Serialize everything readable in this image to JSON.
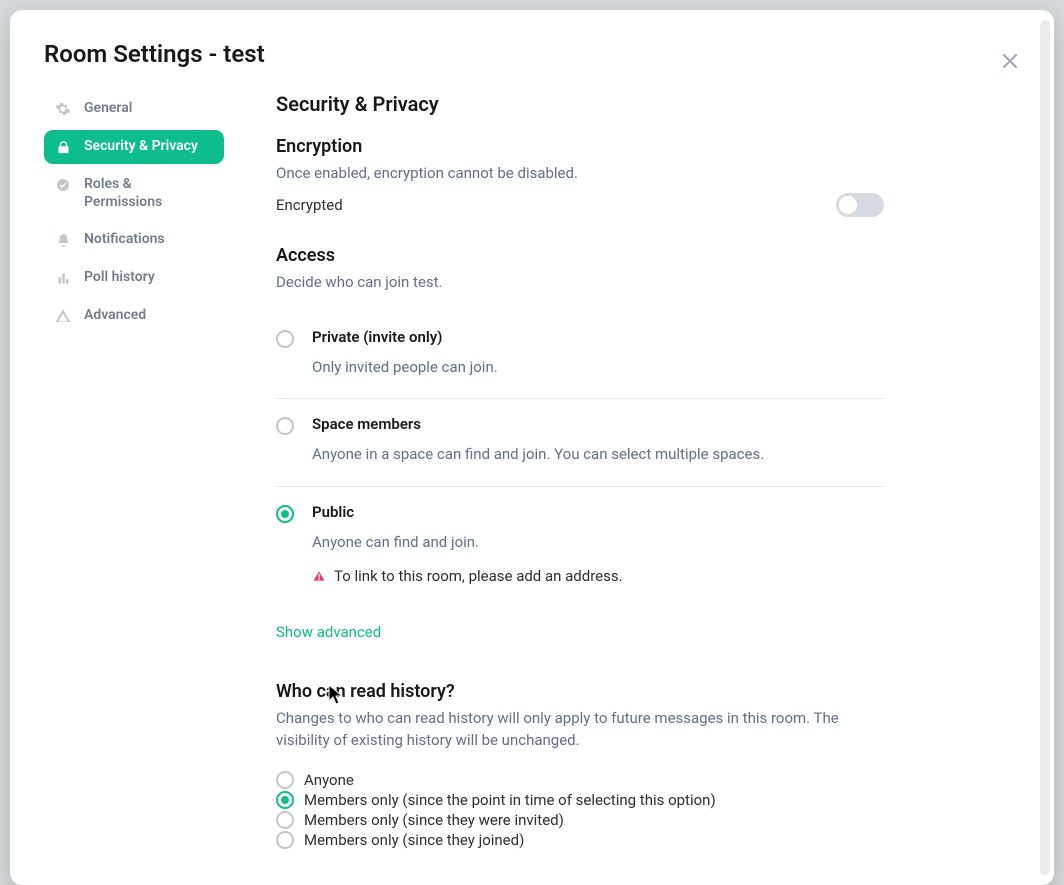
{
  "title": "Room Settings - test",
  "sidebar": {
    "items": [
      {
        "label": "General"
      },
      {
        "label": "Security & Privacy"
      },
      {
        "label": "Roles & Permissions"
      },
      {
        "label": "Notifications"
      },
      {
        "label": "Poll history"
      },
      {
        "label": "Advanced"
      }
    ],
    "active_index": 1
  },
  "main": {
    "heading": "Security & Privacy",
    "encryption": {
      "title": "Encryption",
      "subtitle": "Once enabled, encryption cannot be disabled.",
      "row_label": "Encrypted",
      "enabled": false
    },
    "access": {
      "title": "Access",
      "subtitle": "Decide who can join test.",
      "options": [
        {
          "title": "Private (invite only)",
          "desc": "Only invited people can join."
        },
        {
          "title": "Space members",
          "desc": "Anyone in a space can find and join. You can select multiple spaces."
        },
        {
          "title": "Public",
          "desc": "Anyone can find and join."
        }
      ],
      "selected_index": 2,
      "public_warning": "To link to this room, please add an address.",
      "advanced_link": "Show advanced"
    },
    "history": {
      "title": "Who can read history?",
      "subtitle": "Changes to who can read history will only apply to future messages in this room. The visibility of existing history will be unchanged.",
      "options": [
        "Anyone",
        "Members only (since the point in time of selecting this option)",
        "Members only (since they were invited)",
        "Members only (since they joined)"
      ],
      "selected_index": 1
    }
  }
}
